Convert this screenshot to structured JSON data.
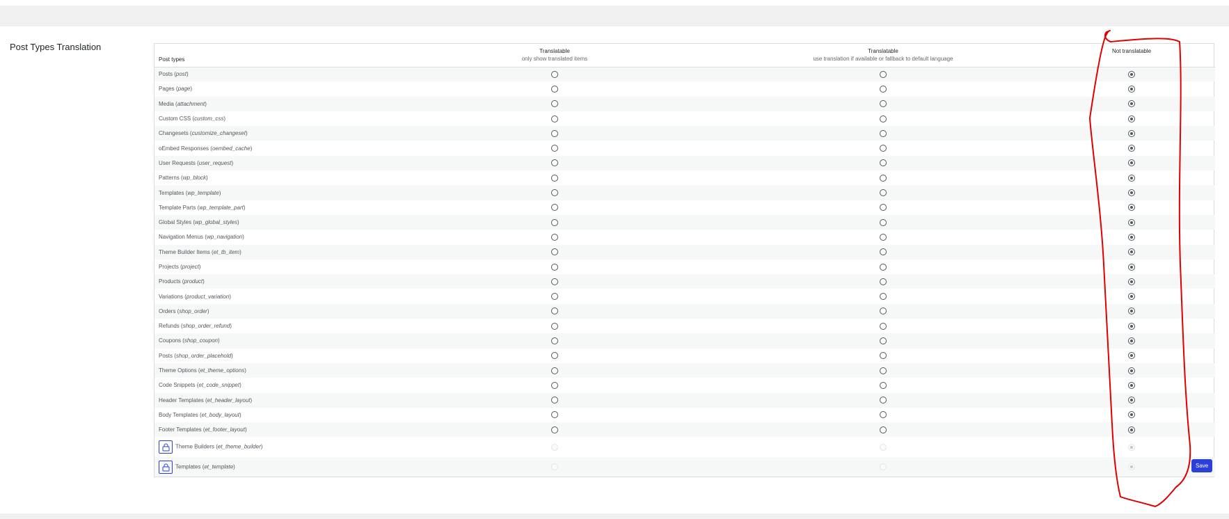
{
  "section": {
    "title": "Post Types Translation"
  },
  "table": {
    "headers": {
      "post_types": "Post types",
      "translatable_1": "Translatable",
      "translatable_1_sub": "only show translated items",
      "translatable_2": "Translatable",
      "translatable_2_sub": "use translation if available or fallback to default language",
      "not_translatable": "Not translatable"
    },
    "rows": [
      {
        "label": "Posts",
        "slug": "post",
        "selected": "not_translatable",
        "locked": false
      },
      {
        "label": "Pages",
        "slug": "page",
        "selected": "not_translatable",
        "locked": false
      },
      {
        "label": "Media",
        "slug": "attachment",
        "selected": "not_translatable",
        "locked": false
      },
      {
        "label": "Custom CSS",
        "slug": "custom_css",
        "selected": "not_translatable",
        "locked": false
      },
      {
        "label": "Changesets",
        "slug": "customize_changeset",
        "selected": "not_translatable",
        "locked": false
      },
      {
        "label": "oEmbed Responses",
        "slug": "oembed_cache",
        "selected": "not_translatable",
        "locked": false
      },
      {
        "label": "User Requests",
        "slug": "user_request",
        "selected": "not_translatable",
        "locked": false
      },
      {
        "label": "Patterns",
        "slug": "wp_block",
        "selected": "not_translatable",
        "locked": false
      },
      {
        "label": "Templates",
        "slug": "wp_template",
        "selected": "not_translatable",
        "locked": false
      },
      {
        "label": "Template Parts",
        "slug": "wp_template_part",
        "selected": "not_translatable",
        "locked": false
      },
      {
        "label": "Global Styles",
        "slug": "wp_global_styles",
        "selected": "not_translatable",
        "locked": false
      },
      {
        "label": "Navigation Menus",
        "slug": "wp_navigation",
        "selected": "not_translatable",
        "locked": false
      },
      {
        "label": "Theme Builder Items",
        "slug": "et_tb_item",
        "selected": "not_translatable",
        "locked": false
      },
      {
        "label": "Projects",
        "slug": "project",
        "selected": "not_translatable",
        "locked": false
      },
      {
        "label": "Products",
        "slug": "product",
        "selected": "not_translatable",
        "locked": false
      },
      {
        "label": "Variations",
        "slug": "product_variation",
        "selected": "not_translatable",
        "locked": false
      },
      {
        "label": "Orders",
        "slug": "shop_order",
        "selected": "not_translatable",
        "locked": false
      },
      {
        "label": "Refunds",
        "slug": "shop_order_refund",
        "selected": "not_translatable",
        "locked": false
      },
      {
        "label": "Coupons",
        "slug": "shop_coupon",
        "selected": "not_translatable",
        "locked": false
      },
      {
        "label": "Posts",
        "slug": "shop_order_placehold",
        "selected": "not_translatable",
        "locked": false
      },
      {
        "label": "Theme Options",
        "slug": "et_theme_options",
        "selected": "not_translatable",
        "locked": false
      },
      {
        "label": "Code Snippets",
        "slug": "et_code_snippet",
        "selected": "not_translatable",
        "locked": false
      },
      {
        "label": "Header Templates",
        "slug": "et_header_layout",
        "selected": "not_translatable",
        "locked": false
      },
      {
        "label": "Body Templates",
        "slug": "et_body_layout",
        "selected": "not_translatable",
        "locked": false
      },
      {
        "label": "Footer Templates",
        "slug": "et_footer_layout",
        "selected": "not_translatable",
        "locked": false
      },
      {
        "label": "Theme Builders",
        "slug": "et_theme_builder",
        "selected": "not_translatable",
        "locked": true
      },
      {
        "label": "Templates",
        "slug": "et_template",
        "selected": "not_translatable",
        "locked": true
      }
    ]
  },
  "actions": {
    "save_label": "Save"
  },
  "colors": {
    "accent": "#2c3fdb",
    "annotation": "#e00000",
    "row_alt": "#f6f7f7"
  },
  "icons": {
    "locked_row": "lock-icon"
  }
}
